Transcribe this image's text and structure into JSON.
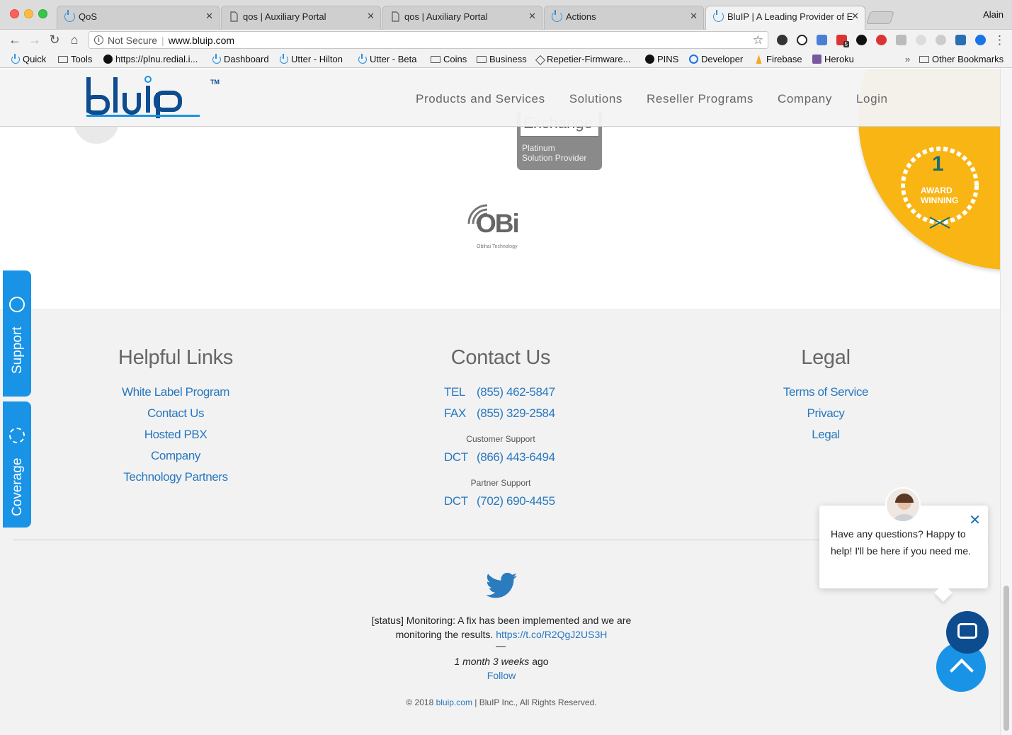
{
  "browser": {
    "tabs": [
      {
        "title": "QoS",
        "icon": "power-icon"
      },
      {
        "title": "qos | Auxiliary Portal",
        "icon": "page-icon"
      },
      {
        "title": "qos | Auxiliary Portal",
        "icon": "page-icon"
      },
      {
        "title": "Actions",
        "icon": "power-icon"
      },
      {
        "title": "BluIP | A Leading Provider of E",
        "icon": "power-icon",
        "active": true
      }
    ],
    "user": "Alain",
    "address": {
      "security": "Not Secure",
      "url": "www.bluip.com"
    },
    "bookmarks": [
      {
        "label": "Quick",
        "icon": "power-icon"
      },
      {
        "label": "Tools",
        "icon": "folder-icon"
      },
      {
        "label": "https://plnu.redial.i...",
        "icon": "badge-icon"
      },
      {
        "label": "Dashboard",
        "icon": "power-icon"
      },
      {
        "label": "Utter - Hilton",
        "icon": "power-icon"
      },
      {
        "label": "Utter - Beta",
        "icon": "power-icon"
      },
      {
        "label": "Coins",
        "icon": "folder-icon"
      },
      {
        "label": "Business",
        "icon": "folder-icon"
      },
      {
        "label": "Repetier-Firmware...",
        "icon": "repetier-icon"
      },
      {
        "label": "PINS",
        "icon": "github-icon"
      },
      {
        "label": "Developer",
        "icon": "developer-icon"
      },
      {
        "label": "Firebase",
        "icon": "firebase-icon"
      },
      {
        "label": "Heroku",
        "icon": "heroku-icon"
      }
    ],
    "bookmarks_overflow": "»",
    "other_bookmarks": "Other Bookmarks",
    "extension_badge": "5"
  },
  "site": {
    "logo_text": "bluIP",
    "logo_tm": "TM",
    "nav": [
      "Products and Services",
      "Solutions",
      "Reseller Programs",
      "Company",
      "Login"
    ],
    "partners": {
      "exchange_title": "Exchange",
      "exchange_sub1": "Platinum",
      "exchange_sub2": "Solution Provider",
      "obi_logo": "OBi",
      "obi_sub": "Obihai Technology"
    },
    "award": {
      "number": "1",
      "line1": "AWARD",
      "line2": "WINNING"
    },
    "side_tabs": {
      "support": "Support",
      "coverage": "Coverage"
    },
    "footer": {
      "helpful": {
        "title": "Helpful Links",
        "links": [
          "White Label Program",
          "Contact Us",
          "Hosted PBX",
          "Company",
          "Technology Partners"
        ]
      },
      "contact": {
        "title": "Contact Us",
        "tel_label": "TEL",
        "tel": "(855) 462-5847",
        "fax_label": "FAX",
        "fax": "(855) 329-2584",
        "customer_support": "Customer Support",
        "cs_label": "DCT",
        "cs_phone": "(866) 443-6494",
        "partner_support": "Partner Support",
        "ps_label": "DCT",
        "ps_phone": "(702) 690-4455"
      },
      "legal": {
        "title": "Legal",
        "links": [
          "Terms of Service",
          "Privacy",
          "Legal"
        ]
      },
      "tweet": {
        "text_before": "[status] Monitoring: A fix has been implemented and we are monitoring the results.",
        "link": "https://t.co/R2QgJ2US3H",
        "dash": "—",
        "time_italic": "1 month 3 weeks",
        "time_suffix": "ago",
        "follow": "Follow"
      },
      "copyright": {
        "prefix": "© 2018",
        "link": "bluip.com",
        "suffix": "| BluIP Inc., All Rights Reserved."
      }
    },
    "chat": {
      "message": "Have any questions? Happy to help! I'll be here if you need me.",
      "close": "✕"
    }
  },
  "colors": {
    "brand_blue": "#1993e5",
    "link_blue": "#2878c0",
    "award_yellow": "#f9b514",
    "chat_navy": "#0d4c8f"
  }
}
